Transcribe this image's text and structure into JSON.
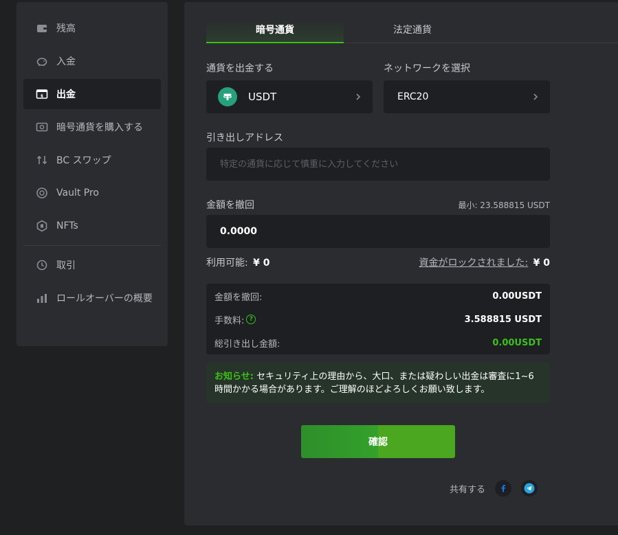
{
  "sidebar": {
    "items": [
      {
        "label": "残高",
        "icon": "wallet-icon"
      },
      {
        "label": "入金",
        "icon": "piggy-bank-icon"
      },
      {
        "label": "出金",
        "icon": "withdraw-icon",
        "active": true
      },
      {
        "label": "暗号通貨を購入する",
        "icon": "buy-crypto-icon"
      },
      {
        "label": "BC スワップ",
        "icon": "swap-icon"
      },
      {
        "label": "Vault Pro",
        "icon": "vault-icon"
      },
      {
        "label": "NFTs",
        "icon": "nft-icon"
      },
      {
        "label": "取引",
        "icon": "transaction-icon"
      },
      {
        "label": "ロールオーバーの概要",
        "icon": "rollover-chart-icon"
      }
    ]
  },
  "tabs": [
    {
      "label": "暗号通貨",
      "active": true
    },
    {
      "label": "法定通貨",
      "active": false
    }
  ],
  "form": {
    "currency_label": "通貨を出金する",
    "currency_value": "USDT",
    "network_label": "ネットワークを選択",
    "network_value": "ERC20",
    "address_label": "引き出しアドレス",
    "address_placeholder": "特定の通貨に応じて慎重に入力してください",
    "amount_label": "金額を撤回",
    "min_text": "最小: 23.588815 USDT",
    "amount_value": "0.0000",
    "available_label": "利用可能:",
    "available_value": "¥ 0",
    "locked_label": "資金がロックされました:",
    "locked_value": "¥ 0"
  },
  "summary": {
    "withdraw_label": "金額を撤回:",
    "withdraw_value": "0.00USDT",
    "fee_label": "手数料:",
    "fee_help": "?",
    "fee_value": "3.588815 USDT",
    "total_label": "総引き出し金額:",
    "total_value": "0.00USDT"
  },
  "notice": {
    "title": "お知らせ:",
    "text": "セキュリティ上の理由から、大口、または疑わしい出金は審査に1~6時間かかる場合があります。ご理解のほどよろしくお願い致します。"
  },
  "confirm_label": "確認",
  "share_label": "共有する",
  "colors": {
    "accent": "#3bc117",
    "usdt": "#26a17b",
    "facebook": "#1877f2",
    "telegram": "#2aa3df"
  }
}
